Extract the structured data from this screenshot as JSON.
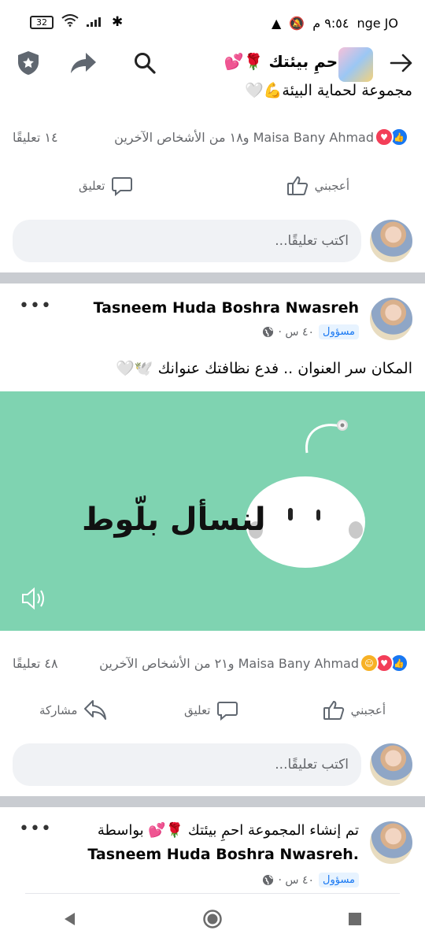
{
  "status": {
    "time": "٩:٥٤ م",
    "carrier": "nge JO",
    "battery": "32"
  },
  "header": {
    "group_name": "احمِ بيئتك 🌹💕"
  },
  "post1": {
    "text_tail": "مجموعة لحماية البيئة💪🤍",
    "reactions_text": "Maisa Bany Ahmad و١٨ من الأشخاص الآخرين",
    "comments_count": "١٤ تعليقًا",
    "like_label": "أعجبني",
    "comment_label": "تعليق",
    "comment_placeholder": "اكتب تعليقًا..."
  },
  "post2": {
    "author": "Tasneem Huda Boshra Nwasreh",
    "badge": "مسؤول",
    "time": "٤٠ س ·",
    "text": "المكان سر العنوان .. فدع نظافتك عنوانك 🕊️🤍",
    "image_caption": "لنسأل بلّوط",
    "reactions_text": "Maisa Bany Ahmad و٢١ من الأشخاص الآخرين",
    "comments_count": "٤٨ تعليقًا",
    "like_label": "أعجبني",
    "comment_label": "تعليق",
    "share_label": "مشاركة",
    "comment_placeholder": "اكتب تعليقًا..."
  },
  "post3": {
    "line1": "تم إنشاء المجموعة احمِ بيئتك 🌹💕 بواسطة",
    "line2": "Tasneem Huda Boshra Nwasreh.",
    "badge": "مسؤول",
    "time": "٤٠ س ·"
  },
  "colors": {
    "like_blue": "#1877f2",
    "love_red": "#f33e58",
    "media_green": "#7fd3b1",
    "admin_badge_bg": "#e7f3ff"
  }
}
